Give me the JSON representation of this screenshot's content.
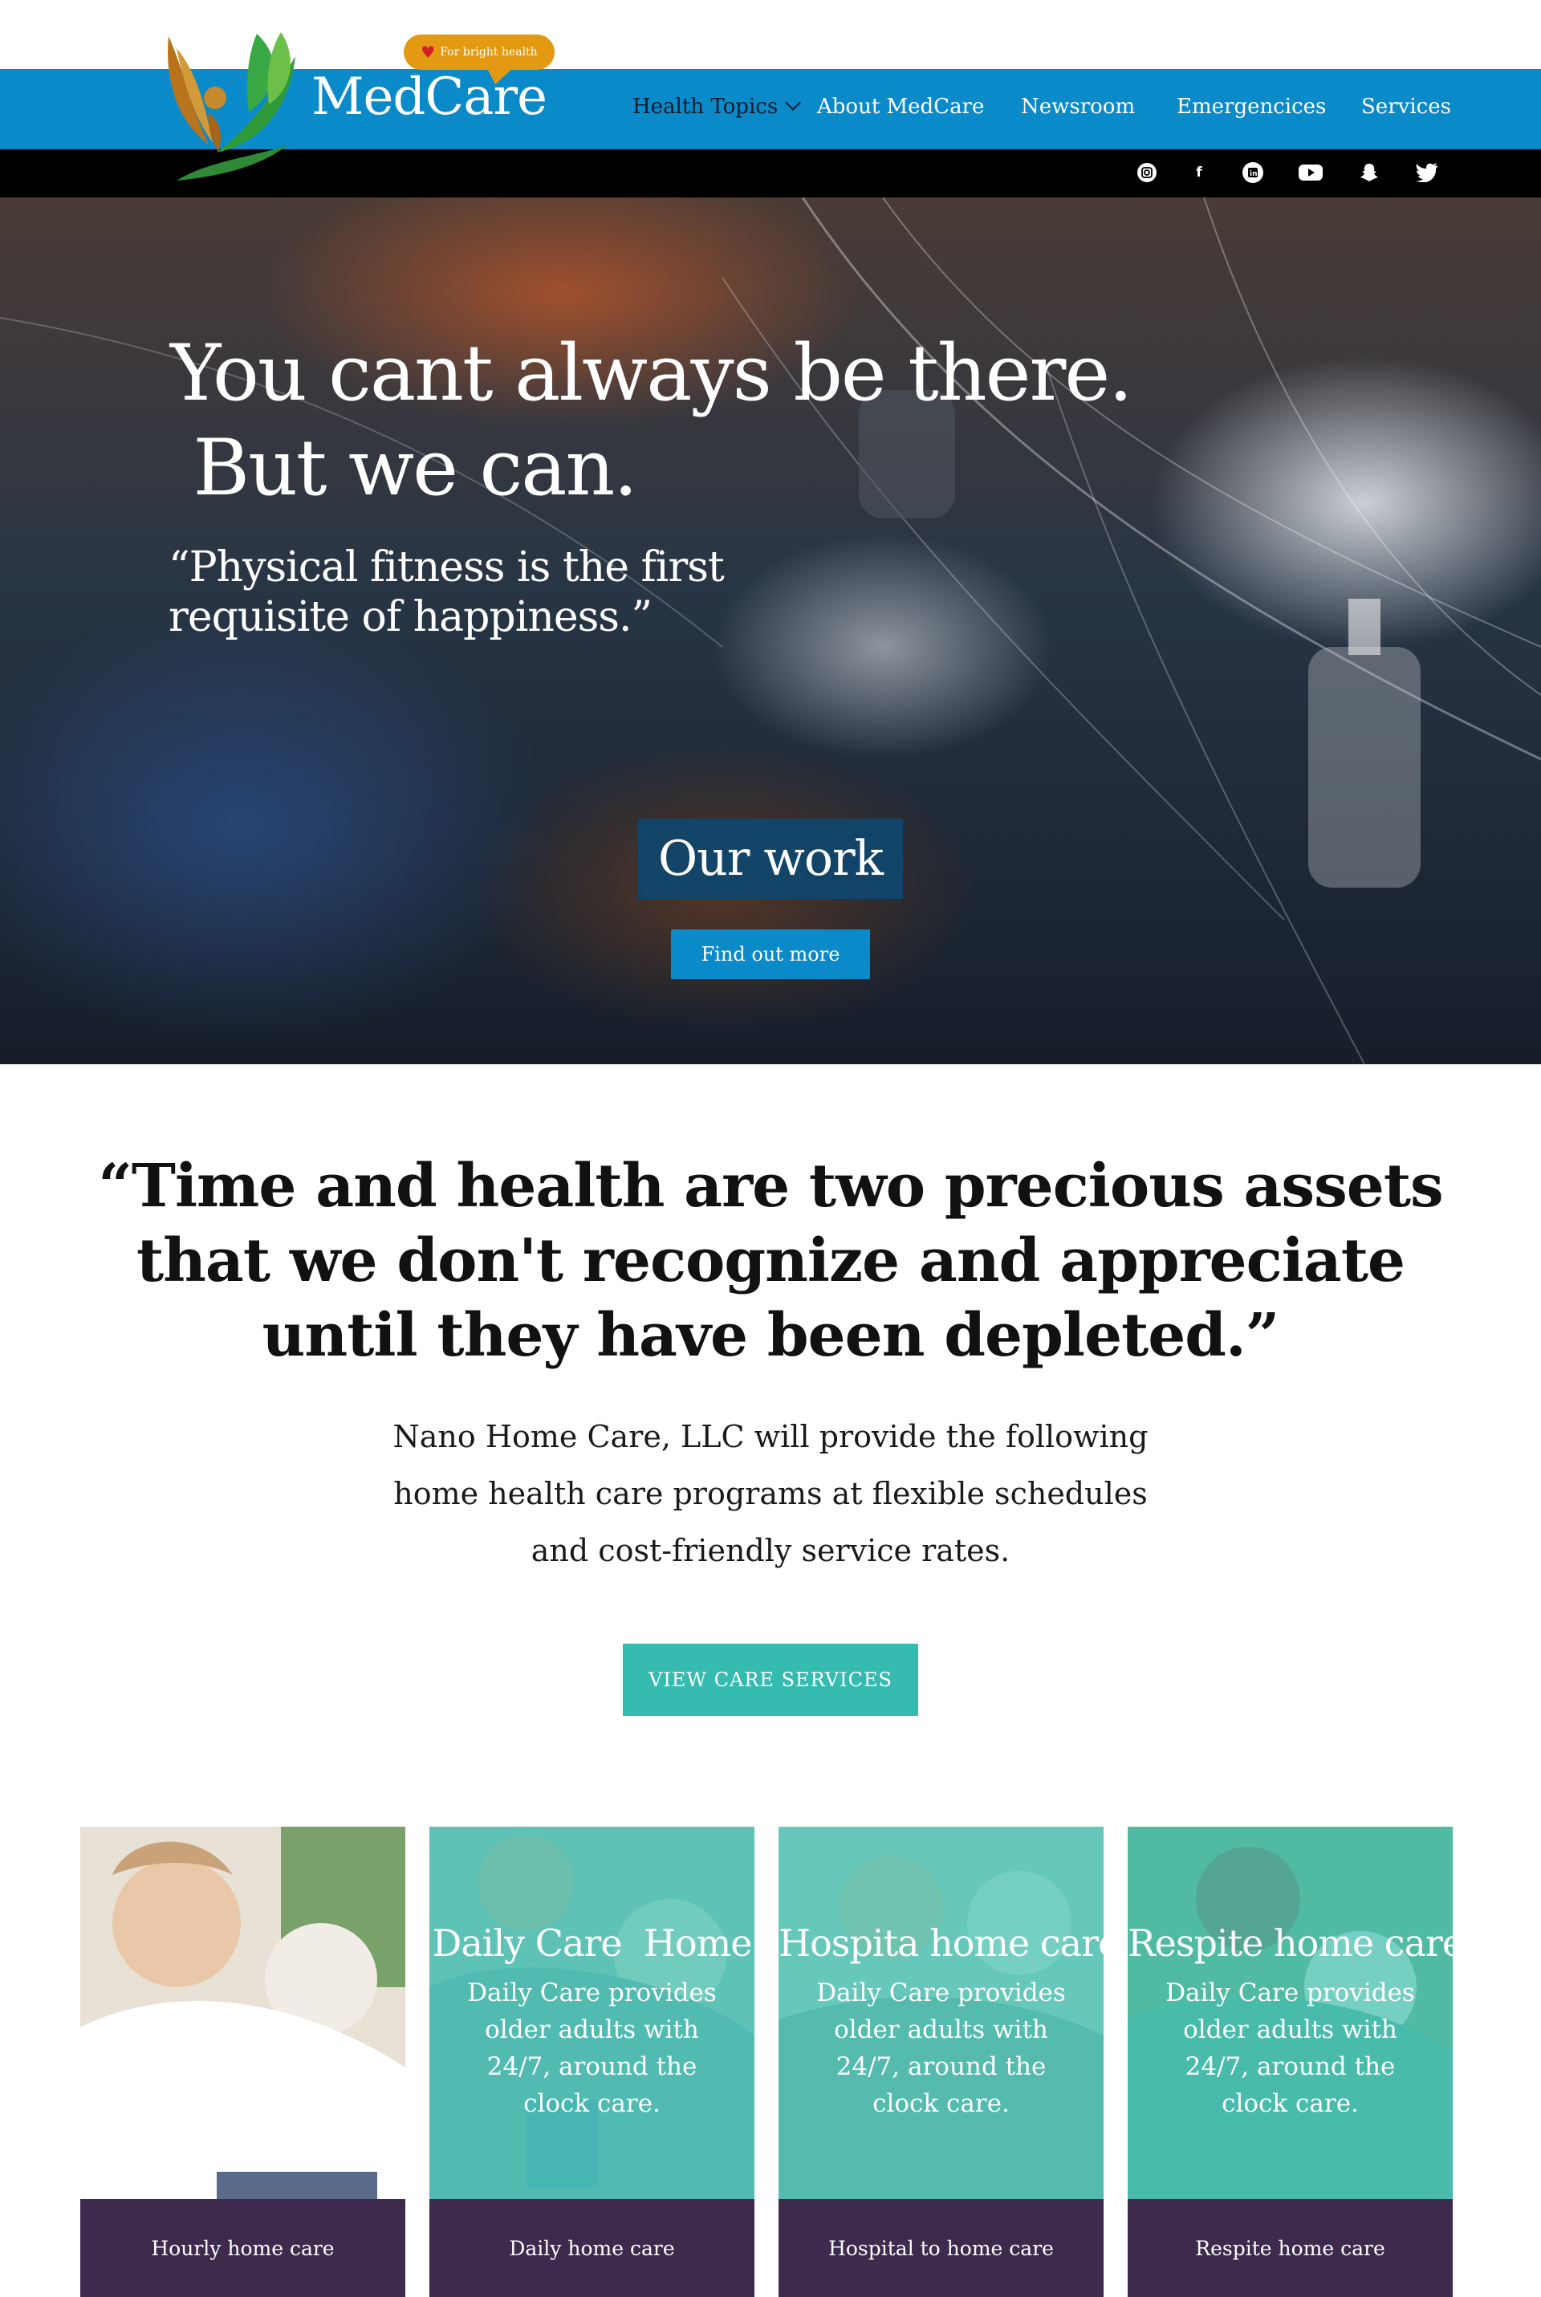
{
  "brand": {
    "name": "MedCare",
    "tagline": "For bright health"
  },
  "nav": {
    "items": [
      {
        "label": "Health Topics"
      },
      {
        "label": "About MedCare"
      },
      {
        "label": "Newsroom"
      },
      {
        "label": "Emergencices"
      },
      {
        "label": "Services"
      }
    ]
  },
  "social": [
    "instagram-icon",
    "facebook-icon",
    "linkedin-icon",
    "youtube-icon",
    "snapchat-icon",
    "twitter-icon"
  ],
  "hero": {
    "title": "You cant always be there.\n But we can.",
    "quote": "“Physical fitness is the first\nrequisite of happiness.”",
    "our_work": "Our work",
    "find_more": "Find out more"
  },
  "quote_section": {
    "quote": "“Time and health are two precious assets that we don't recognize and appreciate until they have been depleted.”",
    "intro": "Nano Home Care, LLC will provide the following home health care programs at flexible schedules and cost-friendly service rates.",
    "button": "VIEW CARE SERVICES"
  },
  "cards": [
    {
      "title": "",
      "desc": "",
      "footer": "Hourly home care"
    },
    {
      "title": "Daily Care  Home",
      "desc": "Daily Care provides older adults with 24/7, around the clock care.",
      "footer": "Daily home care"
    },
    {
      "title": "Hospita home care",
      "desc": "Daily Care provides older adults with 24/7, around the clock care.",
      "footer": "Hospital to home care"
    },
    {
      "title": "Respite home care",
      "desc": "Daily Care provides older adults with 24/7, around the clock care.",
      "footer": "Respite home care"
    }
  ],
  "colors": {
    "primary_blue": "#0a8ac8",
    "teal": "#36bbb0",
    "card_footer": "#3d2a4d",
    "tagline_orange": "#e39a12"
  }
}
